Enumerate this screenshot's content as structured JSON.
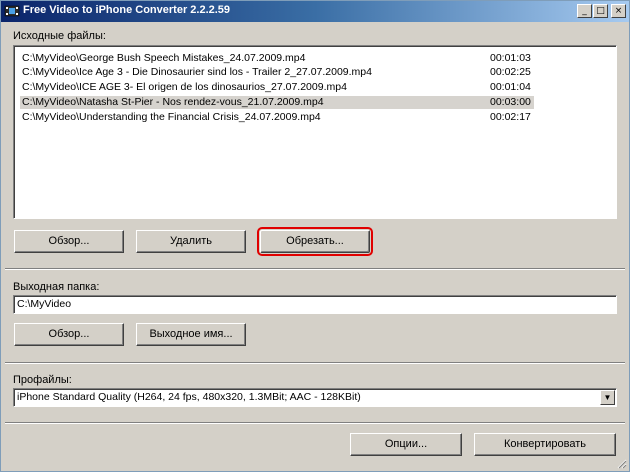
{
  "window": {
    "title": "Free Video to iPhone Converter 2.2.2.59",
    "controls": {
      "minimize": "_",
      "maximize": "□",
      "close": "×"
    }
  },
  "source_files": {
    "label": "Исходные файлы:",
    "items": [
      {
        "path": "C:\\MyVideo\\George Bush Speech Mistakes_24.07.2009.mp4",
        "duration": "00:01:03",
        "selected": false
      },
      {
        "path": "C:\\MyVideo\\Ice Age 3 - Die Dinosaurier sind los - Trailer 2_27.07.2009.mp4",
        "duration": "00:02:25",
        "selected": false
      },
      {
        "path": "C:\\MyVideo\\ICE AGE 3- El origen de los dinosaurios_27.07.2009.mp4",
        "duration": "00:01:04",
        "selected": false
      },
      {
        "path": "C:\\MyVideo\\Natasha St-Pier - Nos rendez-vous_21.07.2009.mp4",
        "duration": "00:03:00",
        "selected": true
      },
      {
        "path": "C:\\MyVideo\\Understanding the Financial Crisis_24.07.2009.mp4",
        "duration": "00:02:17",
        "selected": false
      }
    ],
    "buttons": {
      "browse": "Обзор...",
      "remove": "Удалить",
      "trim": "Обрезать..."
    }
  },
  "output_folder": {
    "label": "Выходная папка:",
    "value": "C:\\MyVideo",
    "buttons": {
      "browse": "Обзор...",
      "output_name": "Выходное имя..."
    }
  },
  "profiles": {
    "label": "Профайлы:",
    "selected": "iPhone Standard Quality (H264, 24 fps, 480x320, 1.3MBit; AAC - 128KBit)"
  },
  "footer": {
    "options": "Опции...",
    "convert": "Конвертировать"
  },
  "colors": {
    "highlight_ring": "#e00000",
    "selected_row": "#d6d3ce",
    "title_start": "#0a246a",
    "title_end": "#a6caf0"
  }
}
